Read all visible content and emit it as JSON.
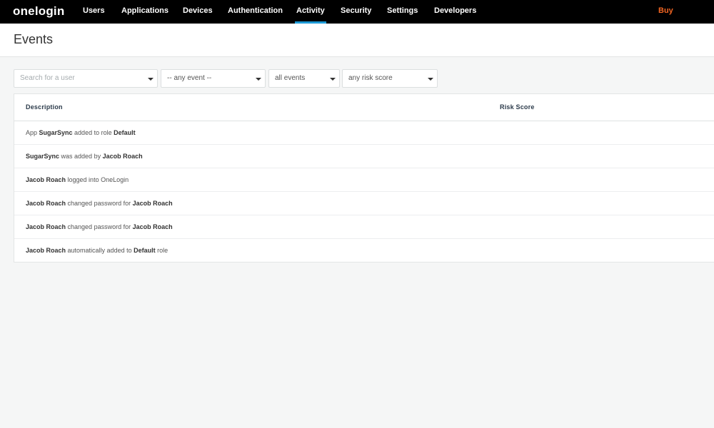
{
  "nav": {
    "logo": "onelogin",
    "items": [
      {
        "label": "Users"
      },
      {
        "label": "Applications"
      },
      {
        "label": "Devices"
      },
      {
        "label": "Authentication"
      },
      {
        "label": "Activity",
        "active": true
      },
      {
        "label": "Security"
      },
      {
        "label": "Settings"
      },
      {
        "label": "Developers"
      }
    ],
    "buy_label": "Buy"
  },
  "page": {
    "title": "Events"
  },
  "filters": {
    "user_search_placeholder": "Search for a user",
    "event_select": "-- any event --",
    "scope_select": "all events",
    "risk_select": "any risk score"
  },
  "table": {
    "headers": {
      "description": "Description",
      "risk_score": "Risk Score"
    },
    "rows": [
      {
        "parts": [
          {
            "t": "App "
          },
          {
            "b": "SugarSync"
          },
          {
            "t": " added to role "
          },
          {
            "b": "Default"
          }
        ]
      },
      {
        "parts": [
          {
            "b": "SugarSync"
          },
          {
            "t": " was added by "
          },
          {
            "b": "Jacob Roach"
          }
        ]
      },
      {
        "parts": [
          {
            "b": "Jacob Roach"
          },
          {
            "t": " logged into OneLogin"
          }
        ]
      },
      {
        "parts": [
          {
            "b": "Jacob Roach"
          },
          {
            "t": " changed password for "
          },
          {
            "b": "Jacob Roach"
          }
        ]
      },
      {
        "parts": [
          {
            "b": "Jacob Roach"
          },
          {
            "t": " changed password for "
          },
          {
            "b": "Jacob Roach"
          }
        ]
      },
      {
        "parts": [
          {
            "b": "Jacob Roach"
          },
          {
            "t": " automatically added to "
          },
          {
            "b": "Default"
          },
          {
            "t": " role"
          }
        ]
      }
    ]
  },
  "colors": {
    "nav_bg": "#000000",
    "active_underline": "#1d9ad6",
    "buy": "#f26522"
  }
}
